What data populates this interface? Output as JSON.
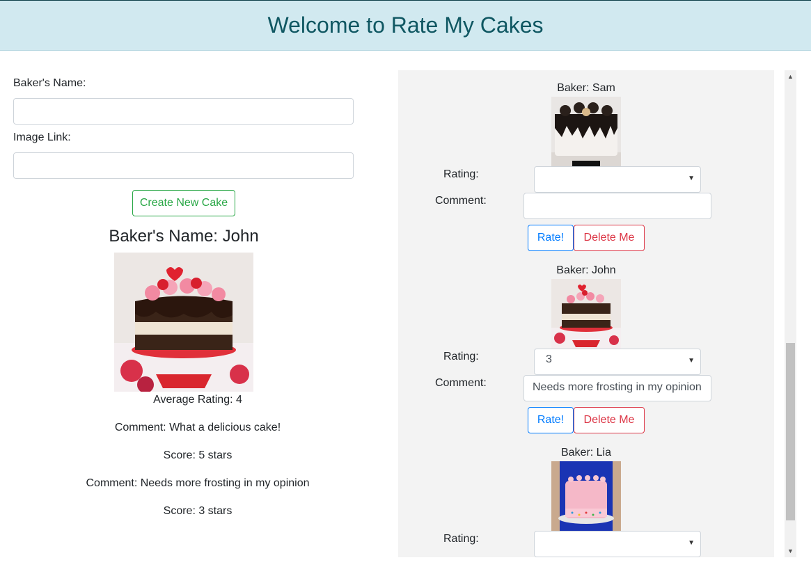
{
  "header": {
    "title": "Welcome to Rate My Cakes"
  },
  "form": {
    "baker_label": "Baker's Name:",
    "baker_value": "",
    "image_label": "Image Link:",
    "image_value": "",
    "create_button": "Create New Cake"
  },
  "detail": {
    "title": "Baker's Name: John",
    "average": "Average Rating: 4",
    "reviews": [
      {
        "comment": "Comment: What a delicious cake!",
        "score": "Score: 5 stars"
      },
      {
        "comment": "Comment: Needs more frosting in my opinion",
        "score": "Score: 3 stars"
      }
    ]
  },
  "cakes": [
    {
      "baker": "Baker: Sam",
      "rating_label": "Rating:",
      "rating_value": "",
      "comment_label": "Comment:",
      "comment_value": "",
      "rate_button": "Rate!",
      "delete_button": "Delete Me"
    },
    {
      "baker": "Baker: John",
      "rating_label": "Rating:",
      "rating_value": "3",
      "comment_label": "Comment:",
      "comment_value": "Needs more frosting in my opinion",
      "rate_button": "Rate!",
      "delete_button": "Delete Me"
    },
    {
      "baker": "Baker: Lia",
      "rating_label": "Rating:",
      "rating_value": ""
    }
  ],
  "colors": {
    "header_bg": "#d1e9f0",
    "header_text": "#0f5762",
    "success": "#28a745",
    "primary": "#007bff",
    "danger": "#dc3545",
    "panel_bg": "#f3f3f3"
  },
  "icons": {
    "select_caret": "caret-down-icon",
    "scroll_up": "scroll-up-arrow-icon",
    "scroll_down": "scroll-down-arrow-icon"
  }
}
